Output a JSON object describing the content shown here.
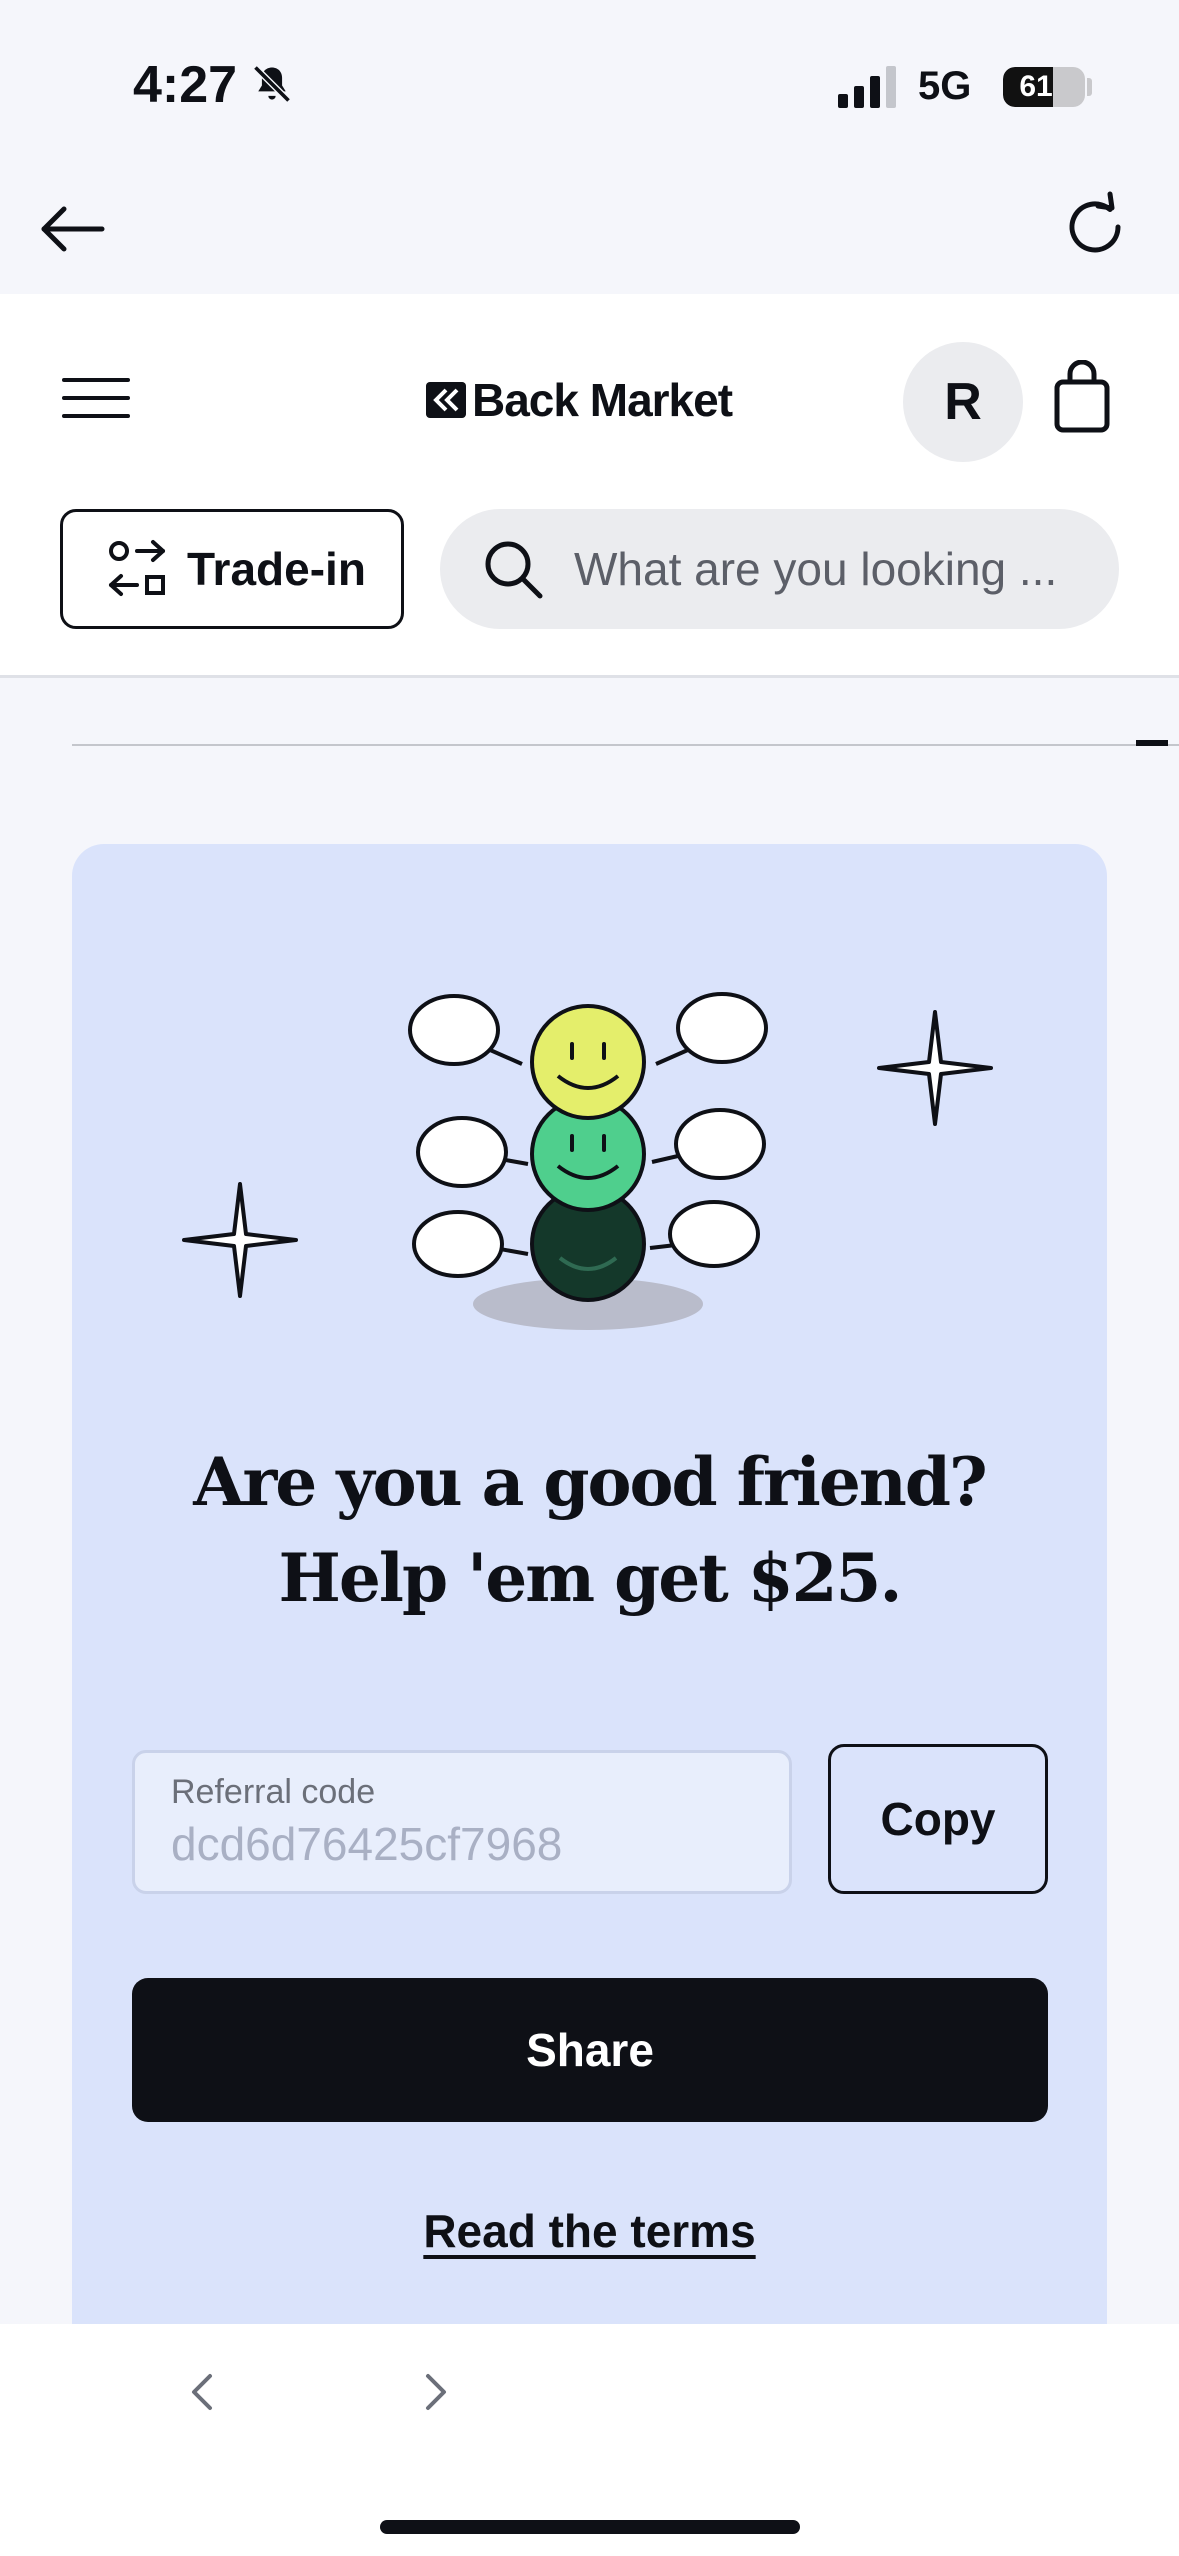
{
  "status_bar": {
    "time": "4:27",
    "network": "5G",
    "battery": "61",
    "battery_level": 0.61
  },
  "icons": {
    "back": "arrow-left-icon",
    "reload": "reload-icon",
    "menu": "hamburger-icon",
    "bag": "shopping-bag-icon",
    "trade_in": "swap-icon",
    "search": "search-icon",
    "silent": "bell-slash-icon"
  },
  "header": {
    "logo": "Back Market",
    "avatar_initial": "R",
    "trade_in_label": "Trade-in",
    "search_placeholder": "What are you looking ..."
  },
  "referral": {
    "headline_line1": "Are you a good friend?",
    "headline_line2": "Help 'em get $25.",
    "code_label": "Referral code",
    "code_value": "dcd6d76425cf7968",
    "copy_label": "Copy",
    "share_label": "Share",
    "terms_label": "Read the terms"
  },
  "toolbar": {
    "back_glyph": "‹",
    "forward_glyph": "›"
  },
  "colors": {
    "card_background": "#dae3fb",
    "primary": "#0e1016",
    "smiley_yellow": "#e4ee6b",
    "smiley_green": "#4fcf8d",
    "smiley_dark": "#14382a"
  }
}
